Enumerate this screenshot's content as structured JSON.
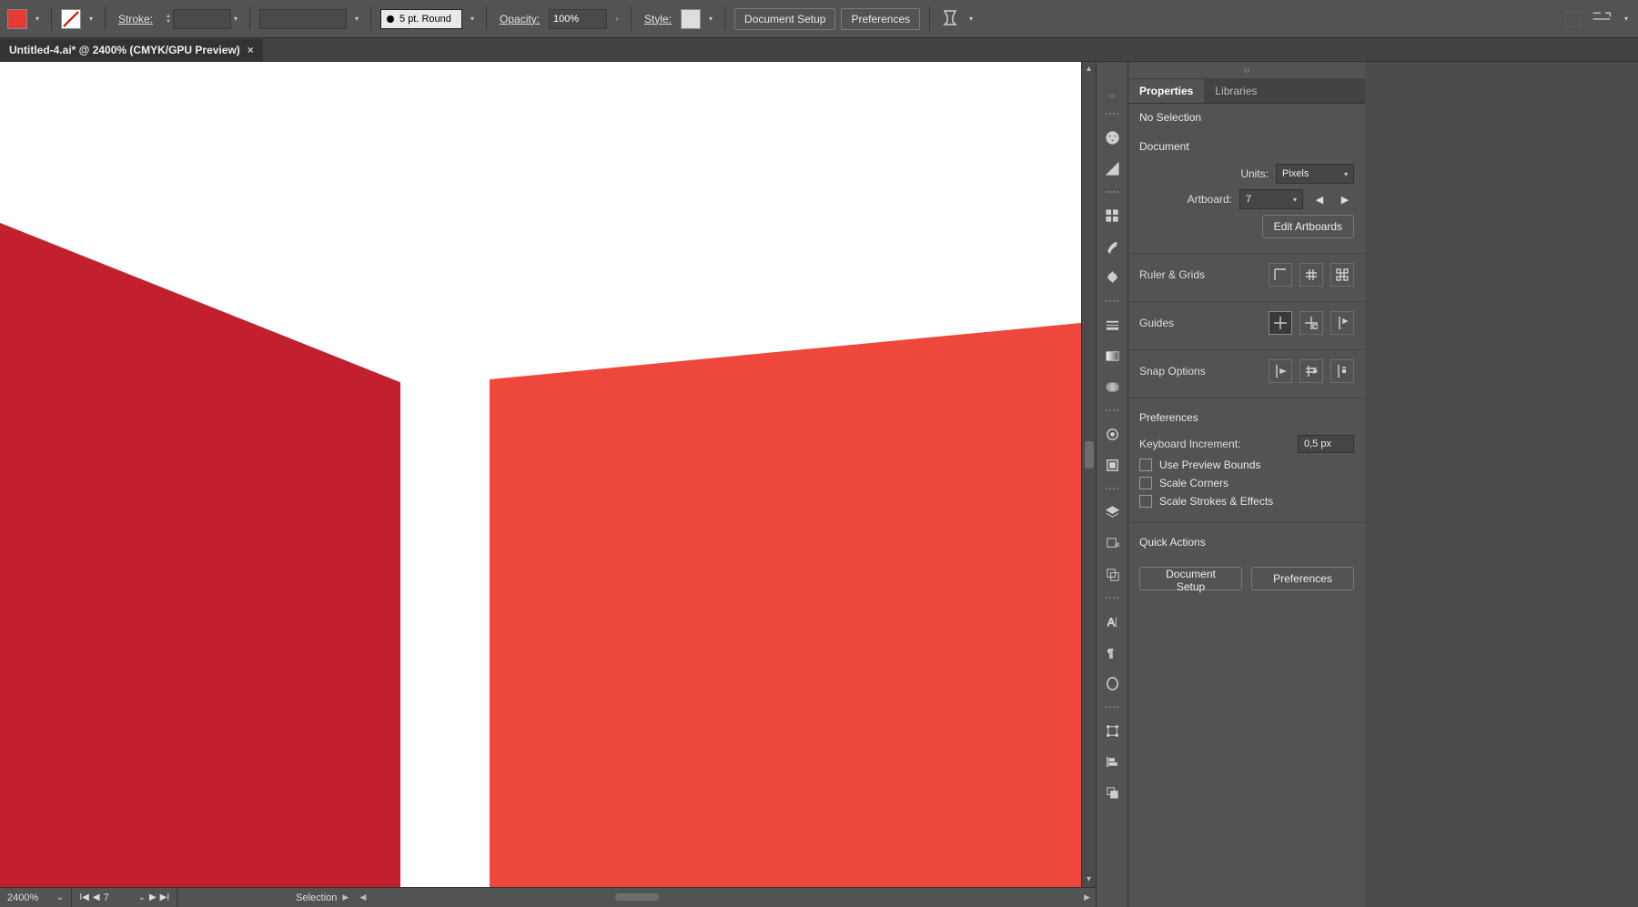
{
  "topbar": {
    "fill_color": "#e73a34",
    "stroke_swatch_none": true,
    "stroke_label": "Stroke:",
    "stroke_value": "",
    "brush_label": "5 pt. Round",
    "opacity_label": "Opacity:",
    "opacity_value": "100%",
    "style_label": "Style:",
    "doc_setup": "Document Setup",
    "preferences": "Preferences"
  },
  "tab": {
    "title": "Untitled-4.ai* @ 2400% (CMYK/GPU Preview)"
  },
  "panel": {
    "tabs": {
      "properties": "Properties",
      "libraries": "Libraries"
    },
    "no_selection": "No Selection",
    "document": {
      "heading": "Document",
      "units_label": "Units:",
      "units_value": "Pixels",
      "artboard_label": "Artboard:",
      "artboard_value": "7",
      "edit_artboards": "Edit Artboards"
    },
    "ruler_grids": "Ruler & Grids",
    "guides": "Guides",
    "snap_options": "Snap Options",
    "prefs": {
      "heading": "Preferences",
      "keyboard_increment_label": "Keyboard Increment:",
      "keyboard_increment_value": "0,5 px",
      "use_preview_bounds": "Use Preview Bounds",
      "scale_corners": "Scale Corners",
      "scale_strokes": "Scale Strokes & Effects"
    },
    "quick_actions": {
      "heading": "Quick Actions",
      "doc_setup": "Document Setup",
      "preferences": "Preferences"
    }
  },
  "status": {
    "zoom": "2400%",
    "artboard": "7",
    "tool": "Selection"
  }
}
